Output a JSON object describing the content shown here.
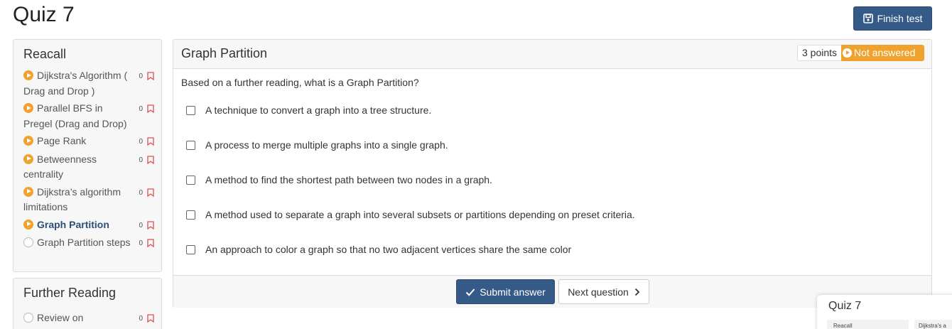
{
  "page": {
    "title": "Quiz 7"
  },
  "header": {
    "finish_label": "Finish test",
    "finish_icon": "save-icon"
  },
  "sidebar": {
    "sections": [
      {
        "title": "Reacall",
        "items": [
          {
            "label": "Dijkstra's Algorithm ( Drag and Drop )",
            "count": "0",
            "state": "started",
            "active": false
          },
          {
            "label": "Parallel BFS in Pregel (Drag and Drop)",
            "count": "0",
            "state": "started",
            "active": false
          },
          {
            "label": "Page Rank",
            "count": "0",
            "state": "started",
            "active": false
          },
          {
            "label": "Betweenness centrality",
            "count": "0",
            "state": "started",
            "active": false
          },
          {
            "label": "Dijkstra’s algorithm limitations",
            "count": "0",
            "state": "started",
            "active": false
          },
          {
            "label": "Graph Partition",
            "count": "0",
            "state": "started",
            "active": true
          },
          {
            "label": "Graph Partition steps",
            "count": "0",
            "state": "empty",
            "active": false
          }
        ]
      },
      {
        "title": "Further Reading",
        "items": [
          {
            "label": "Review on",
            "count": "0",
            "state": "empty",
            "active": false
          }
        ]
      }
    ]
  },
  "question": {
    "title": "Graph Partition",
    "points": "3 points",
    "status": "Not answered",
    "prompt": "Based on a further reading, what is a Graph Partition?",
    "options": [
      "A technique to convert a graph into a tree structure.",
      "A process to merge multiple graphs into a single graph.",
      "A method to find the shortest path between two nodes in a graph.",
      "A method used to separate a graph into several subsets or partitions depending on preset criteria.",
      "An approach to color a graph so that no two adjacent vertices share the same color"
    ],
    "submit_label": "Submit answer",
    "next_label": "Next question"
  },
  "mini_preview": {
    "title": "Quiz 7",
    "left_text": "Reacall",
    "right_text": "Dijkstra's a"
  },
  "colors": {
    "primary": "#355a87",
    "warning": "#f0a22e",
    "bookmark": "#d9534f"
  }
}
